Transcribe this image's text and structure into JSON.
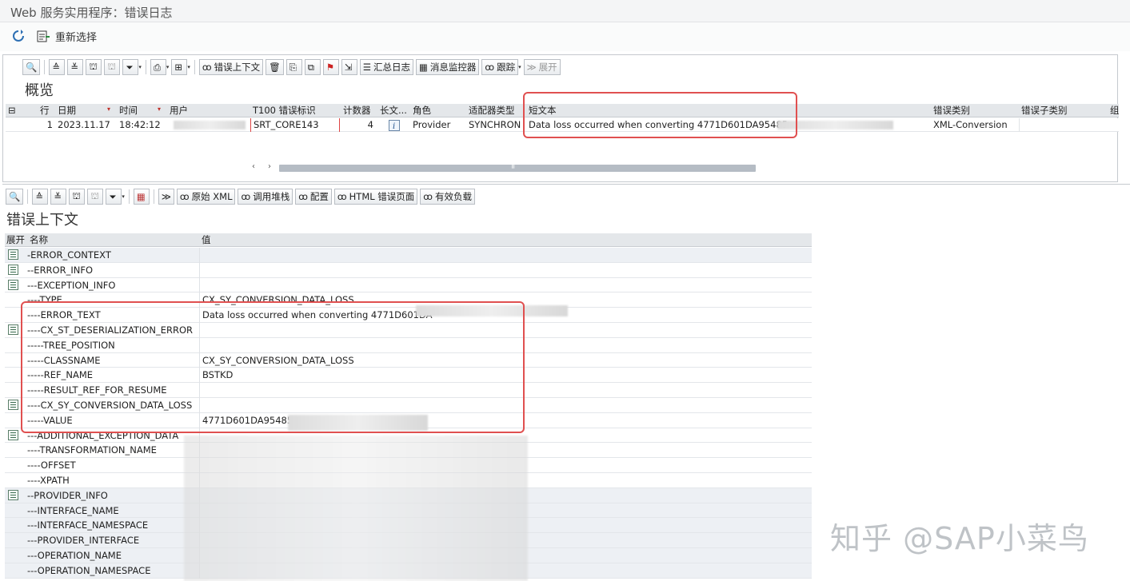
{
  "window": {
    "title": "Web 服务实用程序：错误日志"
  },
  "appbar": {
    "reselect_label": "重新选择"
  },
  "overview": {
    "title": "概览",
    "toolbar": {
      "error_context_label": "错误上下文",
      "summary_log_label": "汇总日志",
      "message_monitor_label": "消息监控器",
      "trace_label": "跟踪",
      "expand_label": "展开"
    },
    "columns": [
      "行",
      "日期",
      "时间",
      "用户",
      "T100 错误标识",
      "计数器",
      "长文...",
      "角色",
      "适配器类型",
      "短文本",
      "错误类别",
      "错误子类别",
      "组"
    ],
    "rows": [
      {
        "row": "1",
        "date": "2023.11.17",
        "time": "18:42:12",
        "user": "",
        "t100": "SRT_CORE143",
        "counter": "4",
        "role": "Provider",
        "adapter": "SYNCHRON",
        "short_text": "Data loss occurred when converting 4771D601DA95485",
        "category": "XML-Conversion",
        "subcategory": ""
      }
    ]
  },
  "context": {
    "title": "错误上下文",
    "toolbar": {
      "raw_xml_label": "原始 XML",
      "call_stack_label": "调用堆栈",
      "config_label": "配置",
      "html_error_label": "HTML 错误页面",
      "payload_label": "有效负载"
    },
    "header": {
      "expand": "展开",
      "name": "名称",
      "value": "值"
    },
    "rows": [
      {
        "expandable": true,
        "shaded": true,
        "name": "-ERROR_CONTEXT",
        "value": ""
      },
      {
        "expandable": true,
        "shaded": false,
        "name": "--ERROR_INFO",
        "value": ""
      },
      {
        "expandable": true,
        "shaded": false,
        "name": "---EXCEPTION_INFO",
        "value": ""
      },
      {
        "expandable": false,
        "shaded": false,
        "name": "----TYPE",
        "value": "CX_SY_CONVERSION_DATA_LOSS"
      },
      {
        "expandable": false,
        "shaded": false,
        "name": "----ERROR_TEXT",
        "value": "Data loss occurred when converting 4771D601DA"
      },
      {
        "expandable": true,
        "shaded": false,
        "name": "----CX_ST_DESERIALIZATION_ERROR",
        "value": ""
      },
      {
        "expandable": false,
        "shaded": false,
        "name": "-----TREE_POSITION",
        "value": ""
      },
      {
        "expandable": false,
        "shaded": false,
        "name": "-----CLASSNAME",
        "value": "CX_SY_CONVERSION_DATA_LOSS"
      },
      {
        "expandable": false,
        "shaded": false,
        "name": "-----REF_NAME",
        "value": "BSTKD"
      },
      {
        "expandable": false,
        "shaded": false,
        "name": "-----RESULT_REF_FOR_RESUME",
        "value": ""
      },
      {
        "expandable": true,
        "shaded": false,
        "name": "----CX_SY_CONVERSION_DATA_LOSS",
        "value": ""
      },
      {
        "expandable": false,
        "shaded": false,
        "name": "-----VALUE",
        "value": "4771D601DA95485"
      },
      {
        "expandable": true,
        "shaded": false,
        "name": "---ADDITIONAL_EXCEPTION_DATA",
        "value": ""
      },
      {
        "expandable": false,
        "shaded": false,
        "name": "----TRANSFORMATION_NAME",
        "value": ""
      },
      {
        "expandable": false,
        "shaded": false,
        "name": "----OFFSET",
        "value": ""
      },
      {
        "expandable": false,
        "shaded": false,
        "name": "----XPATH",
        "value": ""
      },
      {
        "expandable": true,
        "shaded": true,
        "name": "--PROVIDER_INFO",
        "value": ""
      },
      {
        "expandable": false,
        "shaded": true,
        "name": "---INTERFACE_NAME",
        "value": ""
      },
      {
        "expandable": false,
        "shaded": true,
        "name": "---INTERFACE_NAMESPACE",
        "value": ""
      },
      {
        "expandable": false,
        "shaded": true,
        "name": "---PROVIDER_INTERFACE",
        "value": ""
      },
      {
        "expandable": false,
        "shaded": true,
        "name": "---OPERATION_NAME",
        "value": ""
      },
      {
        "expandable": false,
        "shaded": true,
        "name": "---OPERATION_NAMESPACE",
        "value": ""
      }
    ]
  },
  "watermark": "知乎 @SAP小菜鸟",
  "colors": {
    "highlight": "#e05050",
    "grid_header": "#e4e7ea",
    "shaded_row": "#edf0f4"
  }
}
